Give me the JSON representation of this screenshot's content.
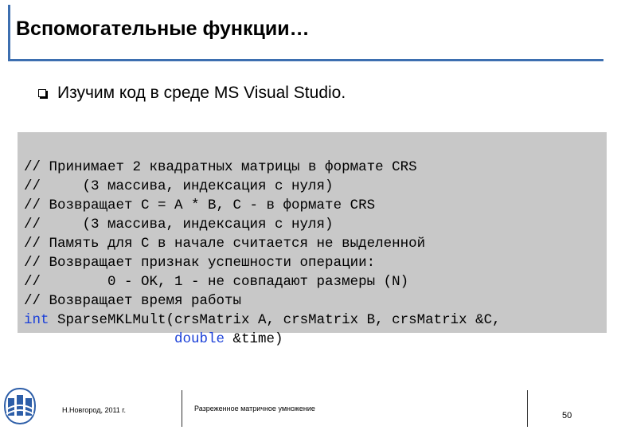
{
  "slide": {
    "title": "Вспомогательные функции…",
    "bullet": "Изучим код в среде MS Visual Studio."
  },
  "code": {
    "lines": [
      "// Принимает 2 квадратных матрицы в формате CRS",
      "//     (3 массива, индексация с нуля)",
      "// Возвращает C = A * B, C - в формате CRS",
      "//     (3 массива, индексация с нуля)",
      "// Память для C в начале считается не выделенной",
      "// Возвращает признак успешности операции:",
      "//        0 - OK, 1 - не совпадают размеры (N)",
      "// Возвращает время работы"
    ],
    "sig_kw": "int",
    "sig_rest": " SparseMKLMult(crsMatrix A, crsMatrix B, crsMatrix &C,",
    "sig2_indent": "                  ",
    "sig2_kw": "double",
    "sig2_rest": " &time)"
  },
  "footer": {
    "city": "Н.Новгород, 2011 г.",
    "topic": "Разреженное матричное умножение",
    "page": "50"
  },
  "colors": {
    "accent": "#3d6fb0",
    "keyword": "#1a3fd8",
    "code_bg": "#c8c8c8"
  }
}
